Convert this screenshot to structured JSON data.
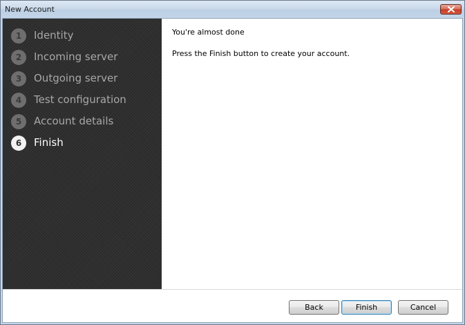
{
  "window": {
    "title": "New Account",
    "close_icon": "close-icon"
  },
  "steps": [
    {
      "number": "1",
      "label": "Identity",
      "active": false
    },
    {
      "number": "2",
      "label": "Incoming server",
      "active": false
    },
    {
      "number": "3",
      "label": "Outgoing server",
      "active": false
    },
    {
      "number": "4",
      "label": "Test configuration",
      "active": false
    },
    {
      "number": "5",
      "label": "Account details",
      "active": false
    },
    {
      "number": "6",
      "label": "Finish",
      "active": true
    }
  ],
  "content": {
    "heading": "You're almost done",
    "message": "Press the Finish button to create your account."
  },
  "buttons": {
    "back": "Back",
    "finish": "Finish",
    "cancel": "Cancel"
  },
  "colors": {
    "sidebar_bg": "#2f2f2f",
    "active_step": "#ffffff",
    "inactive_step": "#a8a8a8"
  }
}
